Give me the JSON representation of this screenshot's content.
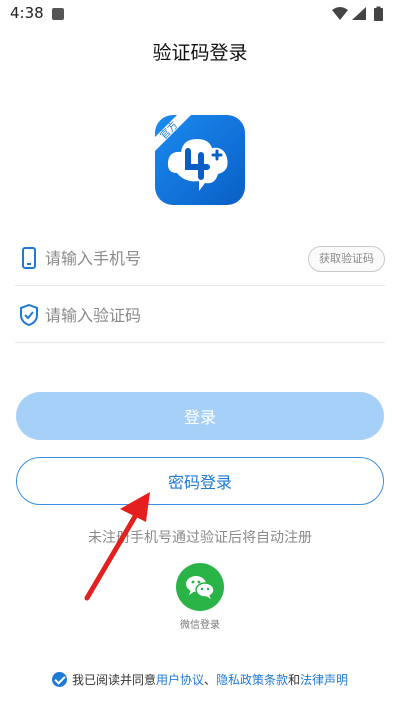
{
  "status_bar": {
    "time": "4:38"
  },
  "header": {
    "title": "验证码登录"
  },
  "logo": {
    "badge": "官方"
  },
  "form": {
    "phone_placeholder": "请输入手机号",
    "get_code_label": "获取验证码",
    "code_placeholder": "请输入验证码"
  },
  "buttons": {
    "login_label": "登录",
    "password_login_label": "密码登录"
  },
  "register_hint": "未注册手机号通过验证后将自动注册",
  "wechat": {
    "label": "微信登录"
  },
  "agreement": {
    "prefix": "我已阅读并同意",
    "user_agreement": "用户协议",
    "separator": "、",
    "privacy_policy": "隐私政策条款",
    "conjunction": "和",
    "legal_notice": "法律声明"
  },
  "colors": {
    "brand_blue": "#1d7ad6",
    "login_disabled": "#a7d0f8",
    "wechat_green": "#2ab448",
    "annotation_red": "#e3201f"
  },
  "icons": [
    "phone-icon",
    "shield-check-icon",
    "wechat-icon",
    "wifi-icon",
    "signal-icon",
    "battery-icon",
    "check-icon"
  ]
}
